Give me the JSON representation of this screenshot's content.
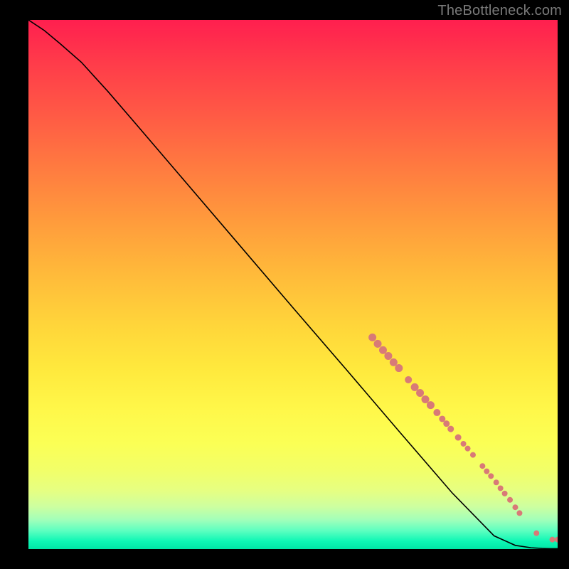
{
  "attribution": "TheBottleneck.com",
  "chart_data": {
    "type": "line",
    "title": "",
    "xlabel": "",
    "ylabel": "",
    "xlim": [
      0,
      100
    ],
    "ylim": [
      0,
      100
    ],
    "curve": {
      "x": [
        0,
        3,
        6,
        10,
        15,
        20,
        30,
        40,
        50,
        60,
        70,
        80,
        88,
        92,
        95,
        97,
        98.5,
        100
      ],
      "y": [
        100,
        98,
        95.5,
        92,
        86.5,
        80.7,
        69,
        57.3,
        45.6,
        34,
        22.3,
        10.7,
        2.5,
        0.7,
        0.25,
        0.12,
        0.08,
        0.08
      ]
    },
    "points": [
      {
        "x": 65.0,
        "y": 40.0,
        "r": 5.5
      },
      {
        "x": 66.0,
        "y": 38.8,
        "r": 5.5
      },
      {
        "x": 67.0,
        "y": 37.6,
        "r": 5.5
      },
      {
        "x": 68.0,
        "y": 36.5,
        "r": 5.5
      },
      {
        "x": 69.0,
        "y": 35.3,
        "r": 5.5
      },
      {
        "x": 70.0,
        "y": 34.2,
        "r": 5.5
      },
      {
        "x": 71.8,
        "y": 32.0,
        "r": 5.0
      },
      {
        "x": 73.0,
        "y": 30.6,
        "r": 5.5
      },
      {
        "x": 74.0,
        "y": 29.5,
        "r": 5.5
      },
      {
        "x": 75.0,
        "y": 28.3,
        "r": 5.5
      },
      {
        "x": 76.0,
        "y": 27.2,
        "r": 5.5
      },
      {
        "x": 77.2,
        "y": 25.8,
        "r": 5.0
      },
      {
        "x": 78.2,
        "y": 24.6,
        "r": 4.5
      },
      {
        "x": 79.0,
        "y": 23.7,
        "r": 4.5
      },
      {
        "x": 79.8,
        "y": 22.7,
        "r": 4.5
      },
      {
        "x": 81.2,
        "y": 21.1,
        "r": 4.5
      },
      {
        "x": 82.2,
        "y": 19.9,
        "r": 4.0
      },
      {
        "x": 83.0,
        "y": 19.0,
        "r": 4.0
      },
      {
        "x": 84.0,
        "y": 17.8,
        "r": 4.0
      },
      {
        "x": 85.8,
        "y": 15.7,
        "r": 4.0
      },
      {
        "x": 86.6,
        "y": 14.7,
        "r": 4.0
      },
      {
        "x": 87.4,
        "y": 13.8,
        "r": 4.0
      },
      {
        "x": 88.4,
        "y": 12.6,
        "r": 4.0
      },
      {
        "x": 89.2,
        "y": 11.5,
        "r": 4.0
      },
      {
        "x": 90.0,
        "y": 10.5,
        "r": 4.0
      },
      {
        "x": 91.0,
        "y": 9.3,
        "r": 4.0
      },
      {
        "x": 92.0,
        "y": 7.9,
        "r": 4.0
      },
      {
        "x": 92.8,
        "y": 6.8,
        "r": 4.0
      },
      {
        "x": 96.0,
        "y": 3.0,
        "r": 4.0
      },
      {
        "x": 99.0,
        "y": 1.8,
        "r": 4.0
      },
      {
        "x": 100.0,
        "y": 1.8,
        "r": 4.0
      }
    ],
    "colors": {
      "gradient_top": "#ff1f4f",
      "gradient_bottom": "#00e6a6",
      "curve": "#000000",
      "points": "#d87a77",
      "frame": "#000000"
    }
  }
}
